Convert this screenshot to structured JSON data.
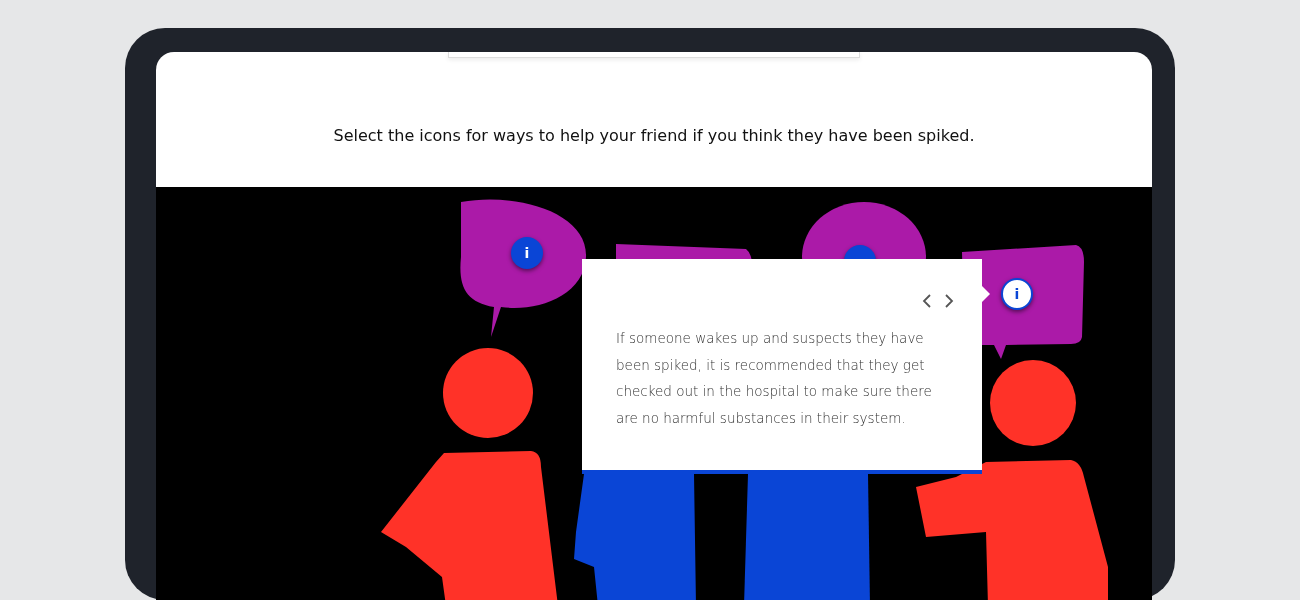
{
  "instruction": "Select the icons for ways to help your friend if you think they have been spiked.",
  "hotspots": [
    {
      "label": "i",
      "selected": false
    },
    {
      "selected": false
    },
    {
      "label": "i",
      "selected": true
    }
  ],
  "popup": {
    "body": "If someone wakes up and suspects they have been spiked, it is recommended that they get checked out in the hospital to make sure there are no harmful substances in their system."
  }
}
